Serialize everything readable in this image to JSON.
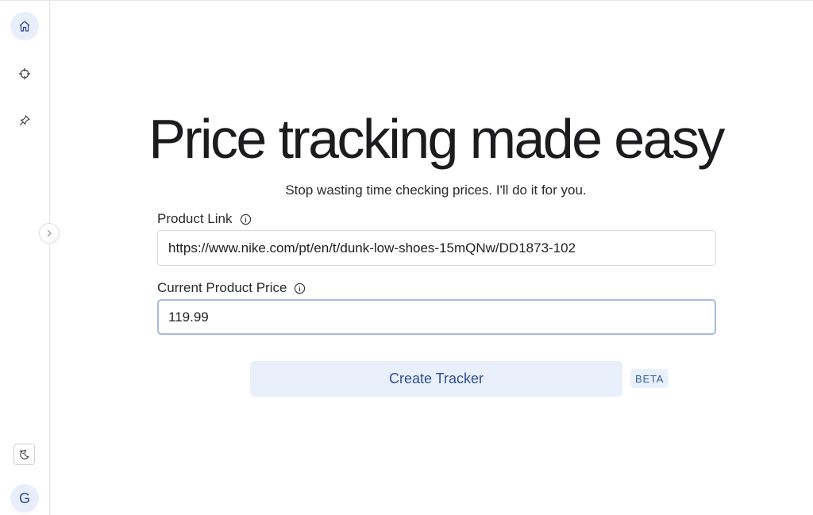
{
  "sidebar": {
    "nav": [
      {
        "icon": "home-icon",
        "active": true
      },
      {
        "icon": "crosshair-icon",
        "active": false
      },
      {
        "icon": "pin-icon",
        "active": false
      }
    ],
    "theme_icon": "moon-stars-icon",
    "avatar_initial": "G"
  },
  "main": {
    "headline": "Price tracking made easy",
    "subtitle": "Stop wasting time checking prices. I'll do it for you.",
    "product_link": {
      "label": "Product Link",
      "value": "https://www.nike.com/pt/en/t/dunk-low-shoes-15mQNw/DD1873-102"
    },
    "current_price": {
      "label": "Current Product Price",
      "value": "119.99"
    },
    "create_button_label": "Create Tracker",
    "beta_badge": "BETA"
  },
  "colors": {
    "accent_bg": "#e9effb",
    "accent_text": "#2e4f8f",
    "focus_border": "#a9b9e3"
  }
}
